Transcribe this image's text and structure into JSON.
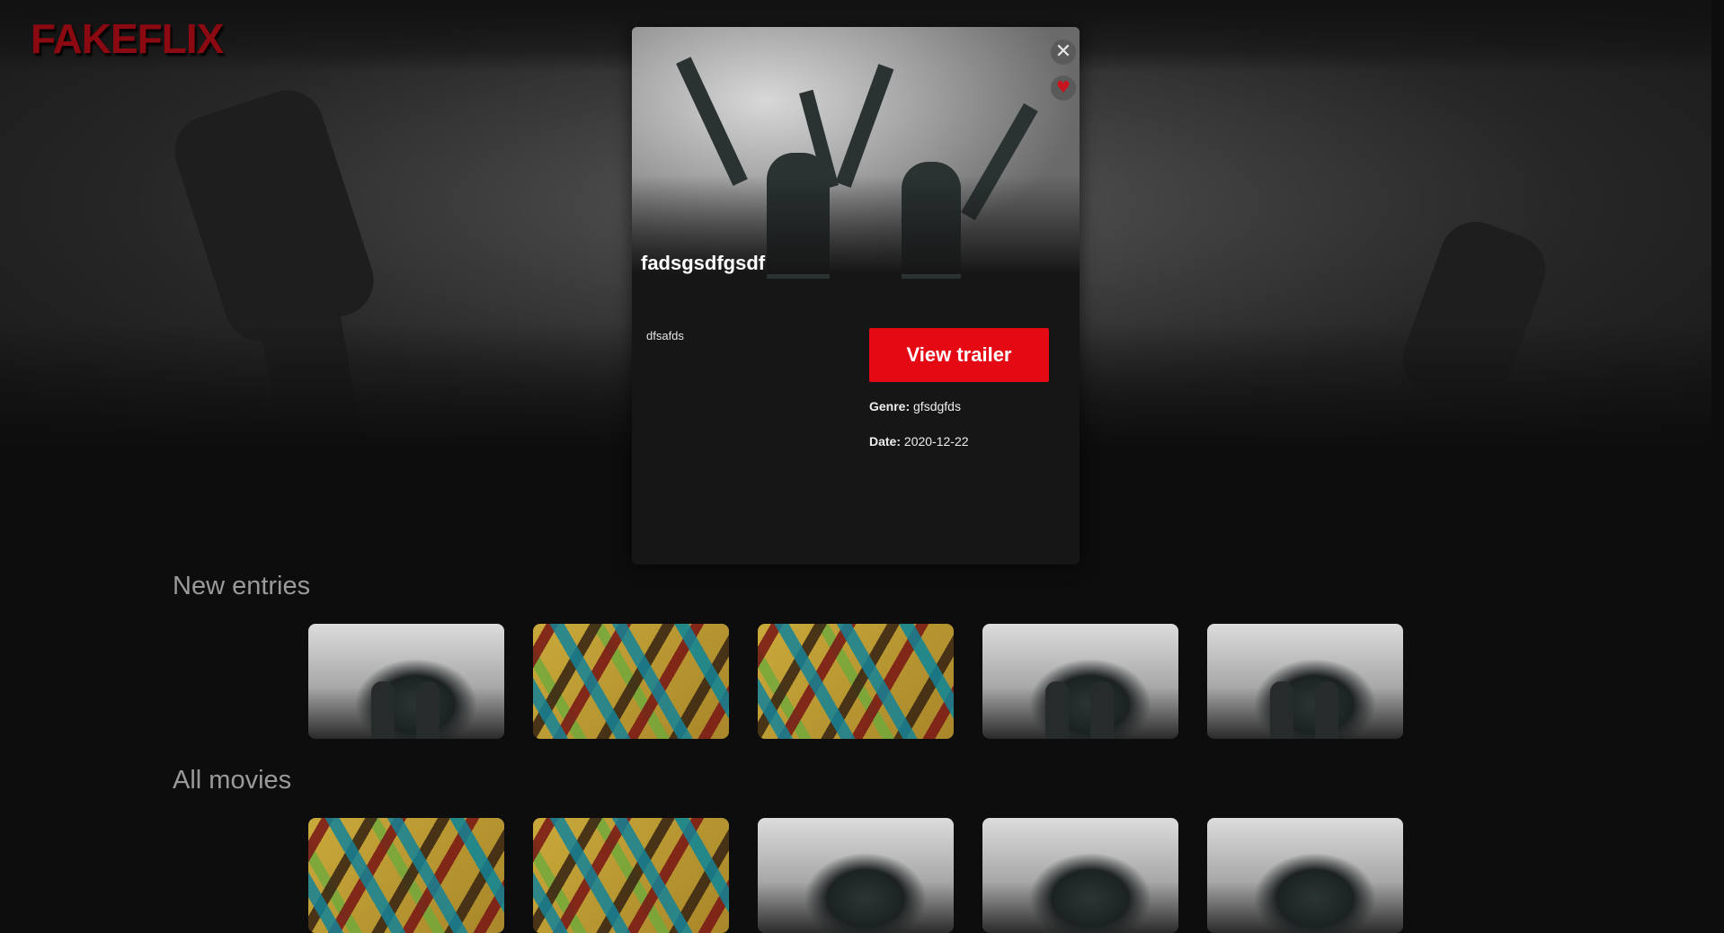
{
  "app": {
    "logo": "FAKEFLIX"
  },
  "modal": {
    "title": "fadsgsdfgsdf",
    "description": "dfsafds",
    "trailer_label": "View trailer",
    "genre_label": "Genre:",
    "genre_value": "gfsdgfds",
    "date_label": "Date:",
    "date_value": "2020-12-22",
    "close_icon": "✕",
    "favorite_icon": "♥"
  },
  "rows": {
    "new_entries": {
      "title": "New entries"
    },
    "all_movies": {
      "title": "All movies"
    }
  },
  "colors": {
    "accent": "#e50914",
    "logo": "#8b0a12",
    "background": "#0d0d0d"
  }
}
